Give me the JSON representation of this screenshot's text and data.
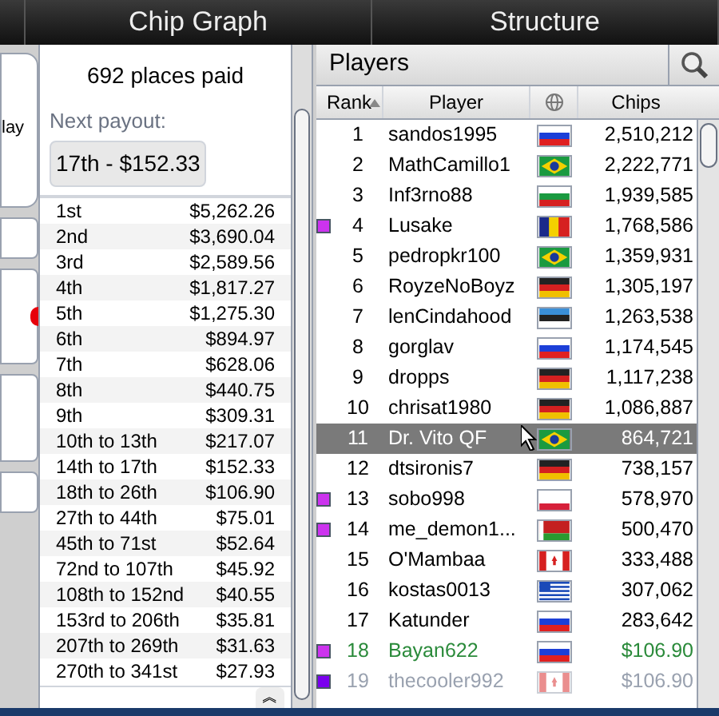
{
  "tabs": [
    {
      "label": "Chip Graph",
      "selected": false
    },
    {
      "label": "Structure",
      "selected": false
    }
  ],
  "left_cards": [
    {
      "text": "lay",
      "alert": false
    },
    {
      "alert": false
    },
    {
      "alert": true
    },
    {
      "alert": false
    },
    {
      "alert": false
    }
  ],
  "payouts": {
    "summary": "692 places paid",
    "next_label": "Next payout:",
    "next_value": "17th - $152.33",
    "collapse_glyph": "︽",
    "rows": [
      [
        "1st",
        "$5,262.26"
      ],
      [
        "2nd",
        "$3,690.04"
      ],
      [
        "3rd",
        "$2,589.56"
      ],
      [
        "4th",
        "$1,817.27"
      ],
      [
        "5th",
        "$1,275.30"
      ],
      [
        "6th",
        "$894.97"
      ],
      [
        "7th",
        "$628.06"
      ],
      [
        "8th",
        "$440.75"
      ],
      [
        "9th",
        "$309.31"
      ],
      [
        "10th to 13th",
        "$217.07"
      ],
      [
        "14th to 17th",
        "$152.33"
      ],
      [
        "18th to 26th",
        "$106.90"
      ],
      [
        "27th to 44th",
        "$75.01"
      ],
      [
        "45th to 71st",
        "$52.64"
      ],
      [
        "72nd to 107th",
        "$45.92"
      ],
      [
        "108th to 152nd",
        "$40.55"
      ],
      [
        "153rd to 206th",
        "$35.81"
      ],
      [
        "207th to 269th",
        "$31.63"
      ],
      [
        "270th to 341st",
        "$27.93"
      ]
    ]
  },
  "players": {
    "title": "Players",
    "columns": [
      "Rank",
      "Player",
      "Chips"
    ],
    "rows": [
      {
        "rank": "1",
        "name": "sandos1995",
        "flag": {
          "kind": "ru"
        },
        "chips": "2,510,212",
        "kind": "active",
        "selected": false
      },
      {
        "rank": "2",
        "name": "MathCamillo1",
        "flag": {
          "kind": "br"
        },
        "chips": "2,222,771",
        "kind": "active",
        "selected": false
      },
      {
        "rank": "3",
        "name": "Inf3rno88",
        "flag": {
          "kind": "bg"
        },
        "chips": "1,939,585",
        "kind": "active",
        "selected": false
      },
      {
        "rank": "4",
        "name": "Lusake",
        "flag": {
          "kind": "ro"
        },
        "chips": "1,768,586",
        "kind": "active",
        "selected": false,
        "color": "#cc33ee"
      },
      {
        "rank": "5",
        "name": "pedropkr100",
        "flag": {
          "kind": "br"
        },
        "chips": "1,359,931",
        "kind": "active",
        "selected": false
      },
      {
        "rank": "6",
        "name": "RoyzeNoBoyz",
        "flag": {
          "kind": "de"
        },
        "chips": "1,305,197",
        "kind": "active",
        "selected": false
      },
      {
        "rank": "7",
        "name": "lenCindahood",
        "flag": {
          "kind": "ee"
        },
        "chips": "1,263,538",
        "kind": "active",
        "selected": false
      },
      {
        "rank": "8",
        "name": "gorglav",
        "flag": {
          "kind": "ru"
        },
        "chips": "1,174,545",
        "kind": "active",
        "selected": false
      },
      {
        "rank": "9",
        "name": "dropps",
        "flag": {
          "kind": "de"
        },
        "chips": "1,117,238",
        "kind": "active",
        "selected": false
      },
      {
        "rank": "10",
        "name": "chrisat1980",
        "flag": {
          "kind": "de"
        },
        "chips": "1,086,887",
        "kind": "active",
        "selected": false
      },
      {
        "rank": "11",
        "name": "Dr. Vito QF",
        "flag": {
          "kind": "br"
        },
        "chips": "864,721",
        "kind": "active",
        "selected": true
      },
      {
        "rank": "12",
        "name": "dtsironis7",
        "flag": {
          "kind": "de"
        },
        "chips": "738,157",
        "kind": "active",
        "selected": false
      },
      {
        "rank": "13",
        "name": "sobo998",
        "flag": {
          "kind": "pl"
        },
        "chips": "578,970",
        "kind": "active",
        "selected": false,
        "color": "#cc33ee"
      },
      {
        "rank": "14",
        "name": "me_demon1...",
        "flag": {
          "kind": "by"
        },
        "chips": "500,470",
        "kind": "active",
        "selected": false,
        "color": "#cc33ee"
      },
      {
        "rank": "15",
        "name": "O'Mambaa",
        "flag": {
          "kind": "ca"
        },
        "chips": "333,488",
        "kind": "active",
        "selected": false
      },
      {
        "rank": "16",
        "name": "kostas0013",
        "flag": {
          "kind": "gr"
        },
        "chips": "307,062",
        "kind": "active",
        "selected": false
      },
      {
        "rank": "17",
        "name": "Katunder",
        "flag": {
          "kind": "ru"
        },
        "chips": "283,642",
        "kind": "active",
        "selected": false
      },
      {
        "rank": "18",
        "name": "Bayan622",
        "flag": {
          "kind": "ru"
        },
        "chips": "$106.90",
        "kind": "paid",
        "selected": false,
        "color": "#cc33ee"
      },
      {
        "rank": "19",
        "name": "thecooler992",
        "flag": {
          "kind": "ca"
        },
        "chips": "$106.90",
        "kind": "out",
        "selected": false,
        "color": "#7a00ee"
      }
    ]
  }
}
